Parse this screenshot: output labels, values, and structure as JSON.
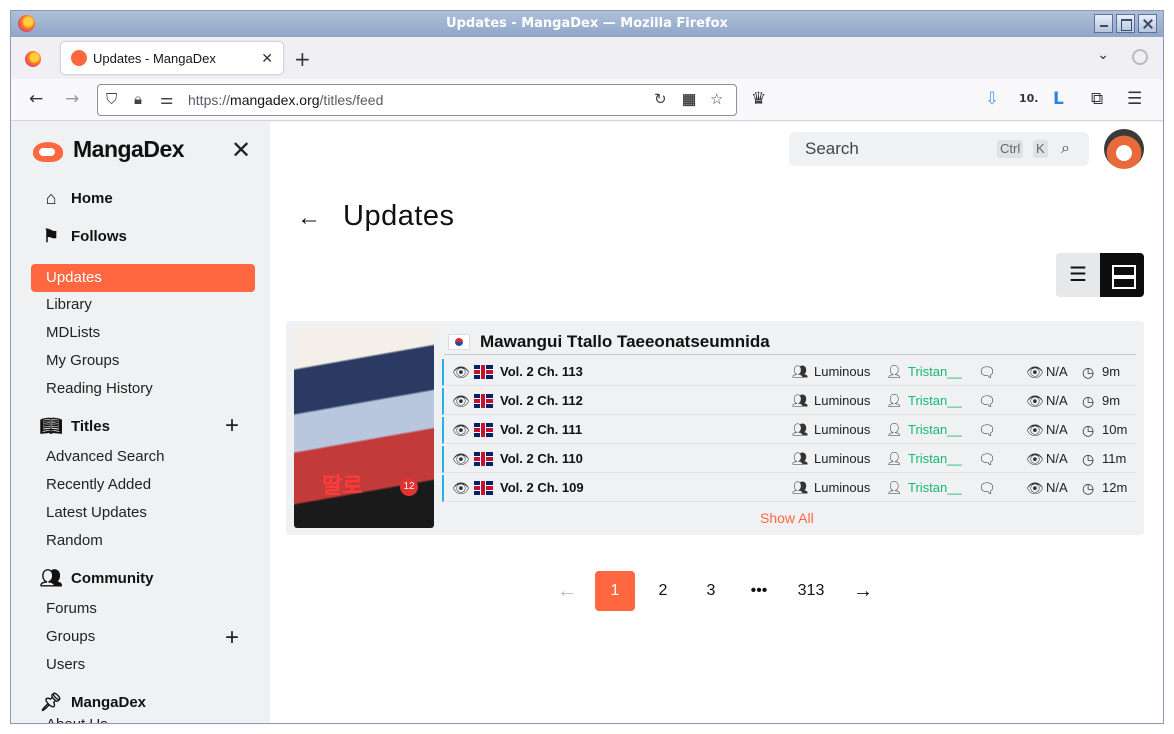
{
  "window": {
    "title": "Updates - MangaDex — Mozilla Firefox"
  },
  "tabs": [
    {
      "label": "Updates - MangaDex",
      "active": true
    }
  ],
  "urlbar": {
    "scheme": "https://",
    "host": "mangadex.org",
    "path": "/titles/feed"
  },
  "browser_icons": {
    "back": "back-arrow-icon",
    "forward": "forward-arrow-icon",
    "downloads": "download-icon",
    "extensions": "puzzle-icon",
    "menu": "hamburger-icon",
    "ext_badge": "10."
  },
  "sidebar": {
    "brand": "MangaDex",
    "home": "Home",
    "follows": "Follows",
    "follows_items": [
      "Updates",
      "Library",
      "MDLists",
      "My Groups",
      "Reading History"
    ],
    "titles": "Titles",
    "titles_items": [
      "Advanced Search",
      "Recently Added",
      "Latest Updates",
      "Random"
    ],
    "community": "Community",
    "community_items": [
      "Forums",
      "Groups",
      "Users"
    ],
    "mangadex": "MangaDex",
    "mangadex_items": [
      "About Us"
    ]
  },
  "header": {
    "search_placeholder": "Search",
    "kbd_ctrl": "Ctrl",
    "kbd_k": "K"
  },
  "page": {
    "title": "Updates"
  },
  "feed": {
    "manga_title": "Mawangui Ttallo Taeeonatseumnida",
    "origin_flag": "kr",
    "chapters": [
      {
        "chapter": "Vol. 2 Ch. 113",
        "group": "Luminous",
        "uploader": "Tristan__",
        "views": "N/A",
        "time": "9m"
      },
      {
        "chapter": "Vol. 2 Ch. 112",
        "group": "Luminous",
        "uploader": "Tristan__",
        "views": "N/A",
        "time": "9m"
      },
      {
        "chapter": "Vol. 2 Ch. 111",
        "group": "Luminous",
        "uploader": "Tristan__",
        "views": "N/A",
        "time": "10m"
      },
      {
        "chapter": "Vol. 2 Ch. 110",
        "group": "Luminous",
        "uploader": "Tristan__",
        "views": "N/A",
        "time": "11m"
      },
      {
        "chapter": "Vol. 2 Ch. 109",
        "group": "Luminous",
        "uploader": "Tristan__",
        "views": "N/A",
        "time": "12m"
      }
    ],
    "show_all": "Show All"
  },
  "pagination": {
    "pages": [
      "1",
      "2",
      "3",
      "•••",
      "313"
    ],
    "current": "1"
  },
  "colors": {
    "accent": "#ff6740",
    "uploader": "#16b873",
    "row_bar": "#27b1e8"
  }
}
